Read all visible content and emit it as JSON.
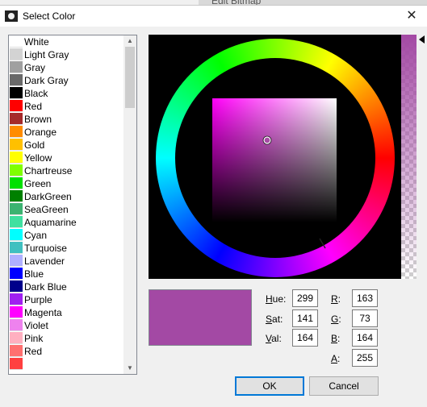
{
  "background": {
    "title_peek": "Edit Bitmap"
  },
  "dialog": {
    "title": "Select Color",
    "close_glyph": "✕"
  },
  "colors": [
    {
      "name": "White",
      "hex": "#ffffff"
    },
    {
      "name": "Light Gray",
      "hex": "#d3d3d3"
    },
    {
      "name": "Gray",
      "hex": "#a0a0a0"
    },
    {
      "name": "Dark Gray",
      "hex": "#696969"
    },
    {
      "name": "Black",
      "hex": "#000000"
    },
    {
      "name": "Red",
      "hex": "#ff0000"
    },
    {
      "name": "Brown",
      "hex": "#a52a2a"
    },
    {
      "name": "Orange",
      "hex": "#ff8c00"
    },
    {
      "name": "Gold",
      "hex": "#ffc000"
    },
    {
      "name": "Yellow",
      "hex": "#ffff00"
    },
    {
      "name": "Chartreuse",
      "hex": "#7fff00"
    },
    {
      "name": "Green",
      "hex": "#00e000"
    },
    {
      "name": "DarkGreen",
      "hex": "#008000"
    },
    {
      "name": "SeaGreen",
      "hex": "#3cb371"
    },
    {
      "name": "Aquamarine",
      "hex": "#40e0a0"
    },
    {
      "name": "Cyan",
      "hex": "#00ffff"
    },
    {
      "name": "Turquoise",
      "hex": "#40c0c0"
    },
    {
      "name": "Lavender",
      "hex": "#b0b0ff"
    },
    {
      "name": "Blue",
      "hex": "#0000ff"
    },
    {
      "name": "Dark Blue",
      "hex": "#00008b"
    },
    {
      "name": "Purple",
      "hex": "#a020f0"
    },
    {
      "name": "Magenta",
      "hex": "#ff00ff"
    },
    {
      "name": "Violet",
      "hex": "#ee82ee"
    },
    {
      "name": "Pink",
      "hex": "#ffb0c0"
    },
    {
      "name": "Red",
      "hex": "#ff7070"
    },
    {
      "name": "",
      "hex": "#ff4040"
    }
  ],
  "current_color": {
    "hex": "#a349a4"
  },
  "hsv": {
    "hue_label": "ue:",
    "hue_key": "H",
    "hue": "299",
    "sat_label": "at:",
    "sat_key": "S",
    "sat": "141",
    "val_label": "al:",
    "val_key": "V",
    "val": "164"
  },
  "rgba": {
    "r_label": ":",
    "r_key": "R",
    "r": "163",
    "g_label": ":",
    "g_key": "G",
    "g": "73",
    "b_label": ":",
    "b_key": "B",
    "b": "164",
    "a_label": ":",
    "a_key": "A",
    "a": "255"
  },
  "buttons": {
    "ok": "OK",
    "cancel": "Cancel"
  }
}
